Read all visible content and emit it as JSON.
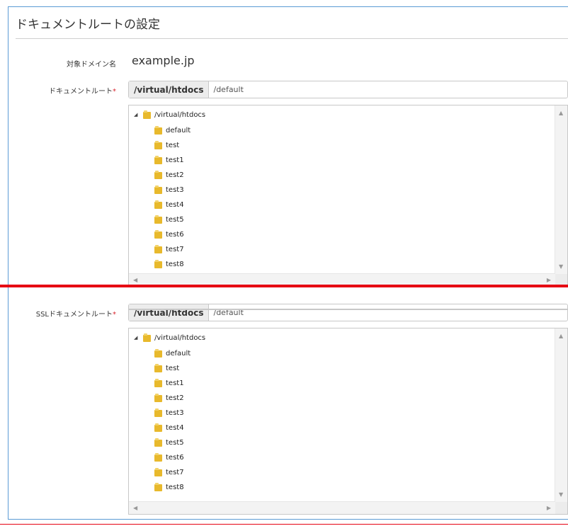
{
  "panel": {
    "title": "ドキュメントルートの設定"
  },
  "domain": {
    "label": "対象ドメイン名",
    "value": "example.jp"
  },
  "docroot": {
    "label": "ドキュメントルート",
    "required_mark": "*",
    "prefix": "/virtual/htdocs",
    "value": "/default",
    "tree": {
      "root": "/virtual/htdocs",
      "children": [
        "default",
        "test",
        "test1",
        "test2",
        "test3",
        "test4",
        "test5",
        "test6",
        "test7",
        "test8"
      ]
    }
  },
  "ssl_docroot": {
    "label": "SSLドキュメントルート",
    "required_mark": "*",
    "prefix": "/virtual/htdocs",
    "value": "/default",
    "tree": {
      "root": "/virtual/htdocs",
      "children": [
        "default",
        "test",
        "test1",
        "test2",
        "test3",
        "test4",
        "test5",
        "test6",
        "test7",
        "test8"
      ]
    }
  },
  "icons": {
    "folder": "folder-icon",
    "expand": "collapse-triangle-icon",
    "scroll_up": "scroll-up-arrow-icon",
    "scroll_down": "scroll-down-arrow-icon",
    "scroll_left": "scroll-left-arrow-icon",
    "scroll_right": "scroll-right-arrow-icon"
  },
  "colors": {
    "panel_border": "#5b9bd5",
    "required": "#d9232d",
    "divider": "#e60012",
    "folder": "#e8b92c"
  }
}
